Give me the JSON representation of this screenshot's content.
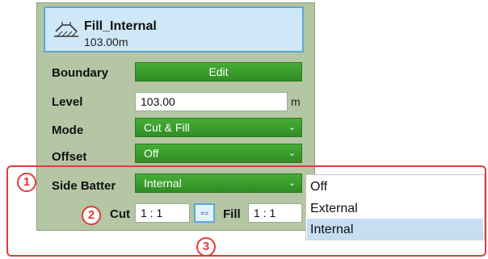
{
  "header": {
    "title": "Fill_Internal",
    "subtitle": "103.00m",
    "icon": "fill-terrain-icon"
  },
  "rows": {
    "boundary": {
      "label": "Boundary",
      "button": "Edit"
    },
    "level": {
      "label": "Level",
      "value": "103.00",
      "unit": "m"
    },
    "mode": {
      "label": "Mode",
      "value": "Cut & Fill"
    },
    "offset": {
      "label": "Offset",
      "value": "Off"
    },
    "side_batter": {
      "label": "Side Batter",
      "value": "Internal"
    }
  },
  "cut": {
    "label": "Cut",
    "value": "1 : 1"
  },
  "fill": {
    "label": "Fill",
    "value": "1 : 1"
  },
  "swap_icon": "swap-arrows-icon",
  "dropdown": {
    "options": [
      "Off",
      "External",
      "Internal"
    ],
    "selected": "Internal"
  },
  "annotations": [
    "1",
    "2",
    "3"
  ],
  "colors": {
    "panel_bg": "#b4c6a4",
    "control_green": "#3a9e2c",
    "header_bg": "#cfe8f7",
    "annotation_red": "#e23b3b",
    "selected_option": "#c6ddf2"
  }
}
